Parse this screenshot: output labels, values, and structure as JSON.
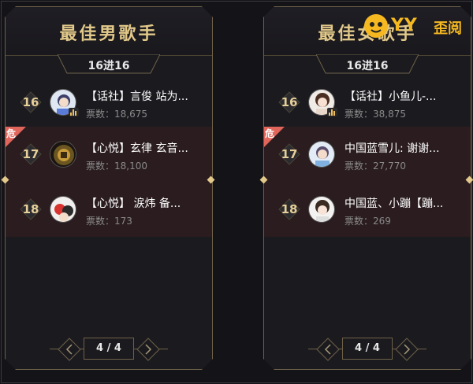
{
  "panels": [
    {
      "title": "最佳男歌手",
      "round": "16进16",
      "rows": [
        {
          "rank": "16",
          "name": "【话社】言俊 站为...",
          "votes": "票数：18,675",
          "danger": false
        },
        {
          "rank": "17",
          "name": "【心悦】玄律 玄音...",
          "votes": "票数：18,100",
          "danger": true,
          "danger_label": "危"
        },
        {
          "rank": "18",
          "name": "【心悦】 涙炜 备...",
          "votes": "票数：173",
          "danger": true
        }
      ],
      "pager": "4 / 4"
    },
    {
      "title": "最佳女歌手",
      "round": "16进16",
      "rows": [
        {
          "rank": "16",
          "name": "【话社】小鱼儿-...",
          "votes": "票数：38,875",
          "danger": false
        },
        {
          "rank": "17",
          "name": "中国蓝雪儿: 谢谢...",
          "votes": "票数：27,770",
          "danger": true,
          "danger_label": "危"
        },
        {
          "rank": "18",
          "name": "中国蓝、小蹦【蹦...",
          "votes": "票数：269",
          "danger": true
        }
      ],
      "pager": "4 / 4"
    }
  ],
  "watermark": {
    "brand": "YY",
    "sub": "歪阅"
  },
  "colors": {
    "gold": "#e2c98a",
    "danger": "#e0655a",
    "panel": "#1b1a1f"
  }
}
